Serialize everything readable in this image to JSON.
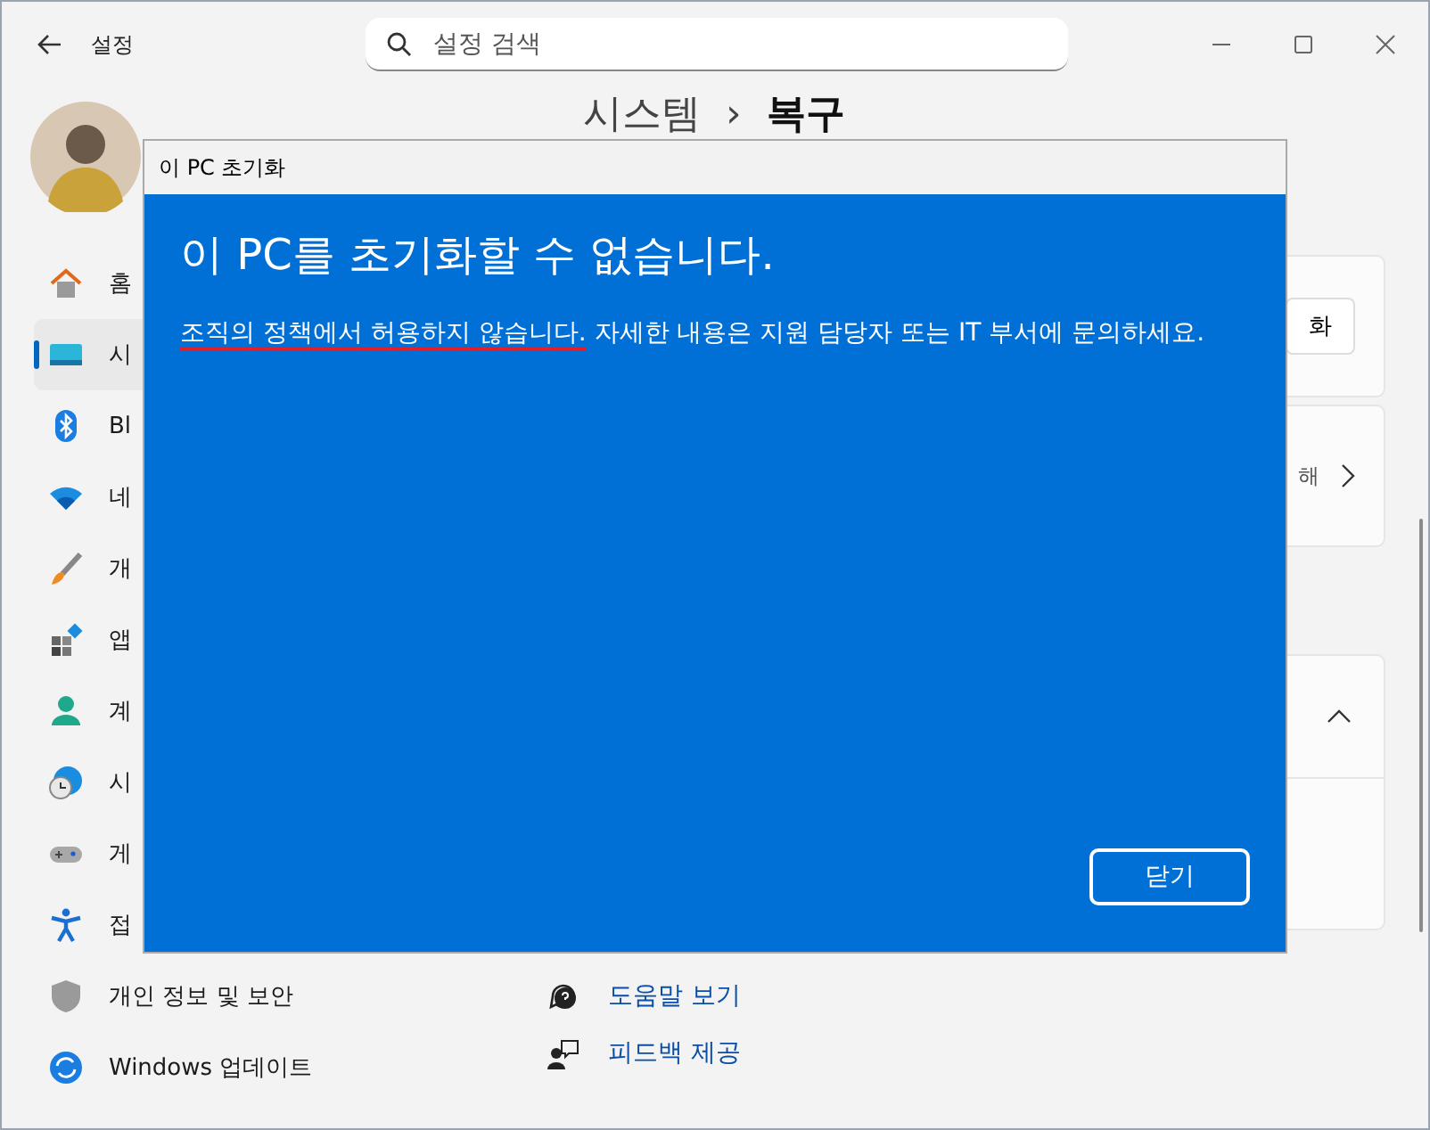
{
  "window": {
    "title": "설정",
    "search_placeholder": "설정 검색"
  },
  "breadcrumb": {
    "parent": "시스템",
    "separator": "›",
    "current": "복구"
  },
  "sidebar": {
    "items": [
      {
        "label": "홈",
        "selected": false
      },
      {
        "label": "시",
        "selected": true
      },
      {
        "label": "Bl",
        "selected": false
      },
      {
        "label": "네",
        "selected": false
      },
      {
        "label": "개",
        "selected": false
      },
      {
        "label": "앱",
        "selected": false
      },
      {
        "label": "계",
        "selected": false
      },
      {
        "label": "시",
        "selected": false
      },
      {
        "label": "게",
        "selected": false
      },
      {
        "label": "접",
        "selected": false
      },
      {
        "label": "개인 정보 및 보안",
        "selected": false
      },
      {
        "label": "Windows 업데이트",
        "selected": false
      }
    ]
  },
  "cards": [
    {
      "kind": "button",
      "text": "화"
    },
    {
      "kind": "link",
      "text": "해"
    },
    {
      "kind": "expander",
      "expanded": true
    }
  ],
  "links": [
    {
      "label": "도움말 보기"
    },
    {
      "label": "피드백 제공"
    }
  ],
  "dialog": {
    "title": "이 PC 초기화",
    "heading": "이 PC를 초기화할 수 없습니다.",
    "message_highlight": "조직의 정책에서 허용하지 않습니다.",
    "message_rest": "자세한 내용은 지원 담당자 또는 IT 부서에 문의하세요.",
    "button": "닫기"
  }
}
